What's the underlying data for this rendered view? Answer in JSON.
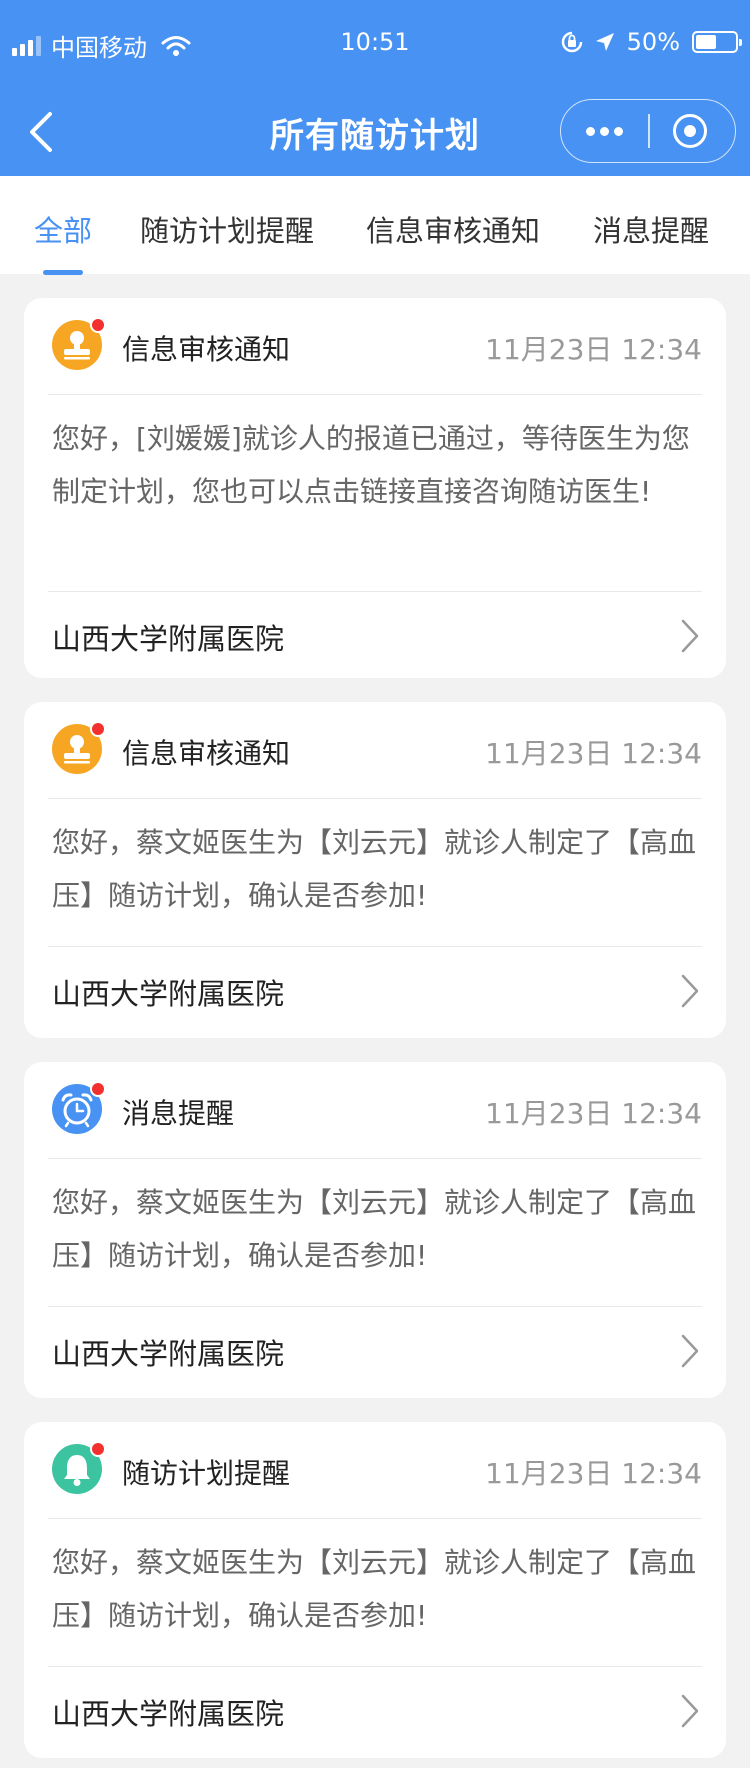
{
  "status_bar": {
    "carrier": "中国移动",
    "time": "10:51",
    "battery": "50%",
    "battery_level": 0.5,
    "icons": [
      "signal-icon",
      "wifi-icon",
      "rotation-lock-icon",
      "location-arrow-icon",
      "battery-icon"
    ]
  },
  "nav": {
    "title": "所有随访计划",
    "icons": [
      "back-icon",
      "more-icon",
      "close-miniprogram-icon"
    ]
  },
  "tabs": [
    {
      "label": "全部",
      "active": true
    },
    {
      "label": "随访计划提醒",
      "active": false
    },
    {
      "label": "信息审核通知",
      "active": false
    },
    {
      "label": "消息提醒",
      "active": false
    }
  ],
  "cards": [
    {
      "type": "信息审核通知",
      "icon": "stamp-icon",
      "icon_color": "#f6a623",
      "time": "11月23日  12:34",
      "body": "您好，[刘媛媛]就诊人的报道已通过，等待医生为您制定计划，您也可以点击链接直接咨询随访医生!",
      "hospital": "山西大学附属医院"
    },
    {
      "type": "信息审核通知",
      "icon": "stamp-icon",
      "icon_color": "#f6a623",
      "time": "11月23日  12:34",
      "body": "您好，蔡文姬医生为【刘云元】就诊人制定了【高血压】随访计划，确认是否参加!",
      "hospital": "山西大学附属医院"
    },
    {
      "type": "消息提醒",
      "icon": "alarm-clock-icon",
      "icon_color": "#4792f2",
      "time": "11月23日  12:34",
      "body": "您好，蔡文姬医生为【刘云元】就诊人制定了【高血压】随访计划，确认是否参加!",
      "hospital": "山西大学附属医院"
    },
    {
      "type": "随访计划提醒",
      "icon": "bell-icon",
      "icon_color": "#3cc3a0",
      "time": "11月23日  12:34",
      "body": "您好，蔡文姬医生为【刘云元】就诊人制定了【高血压】随访计划，确认是否参加!",
      "hospital": "山西大学附属医院"
    }
  ],
  "colors": {
    "primary": "#4792f2",
    "badge": "#f2302e",
    "background": "#f2f2f2"
  }
}
